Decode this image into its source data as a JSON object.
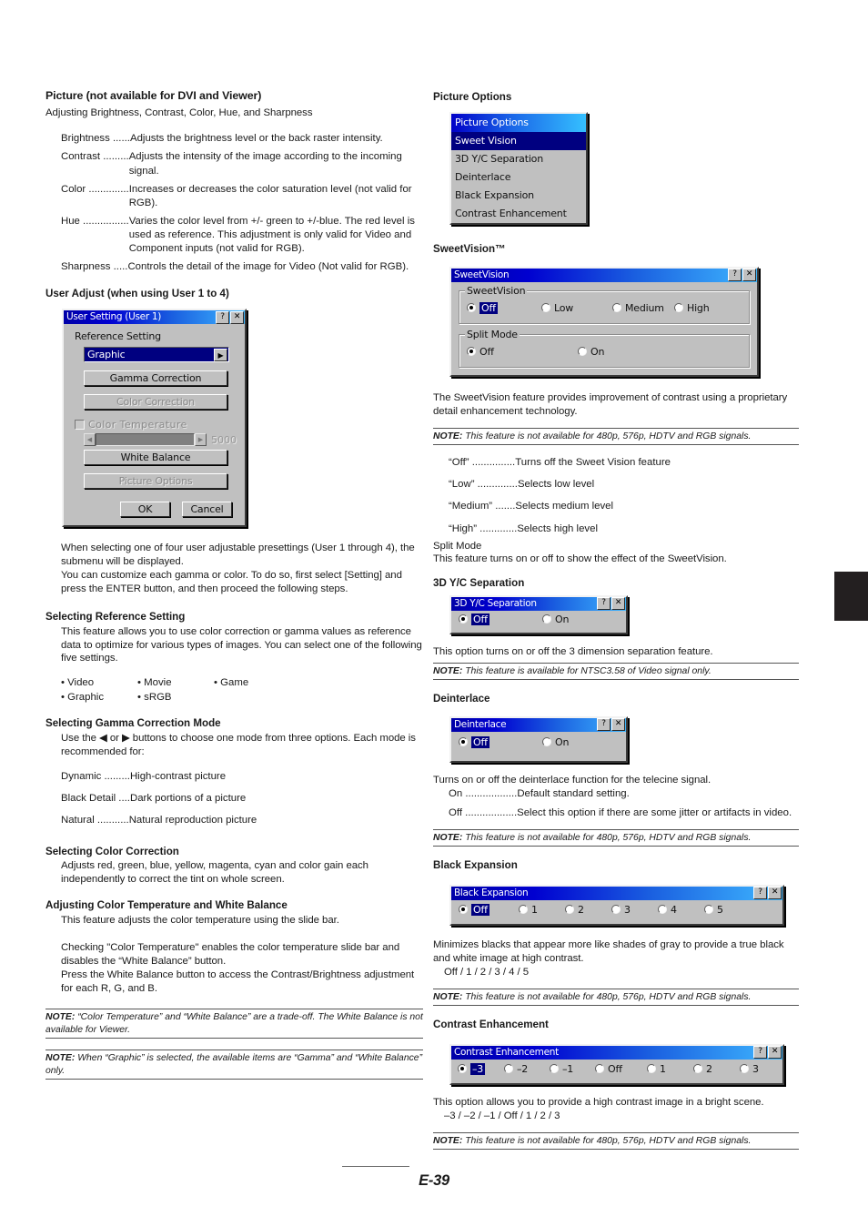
{
  "page": {
    "number": "E-39"
  },
  "left": {
    "heading": "Picture (not available for DVI and Viewer)",
    "subheading": "Adjusting Brightness, Contrast, Color, Hue, and Sharpness",
    "picture_items": [
      {
        "term": "Brightness ......",
        "desc": "Adjusts the brightness level or the back raster intensity."
      },
      {
        "term": "Contrast .........",
        "desc": "Adjusts the intensity of the image according to the incoming signal."
      },
      {
        "term": "Color ..............",
        "desc": "Increases or decreases the color saturation level (not valid for RGB)."
      },
      {
        "term": "Hue ................",
        "desc": "Varies the color level from +/- green to +/-blue. The red level is used as reference. This adjustment is only valid for Video and Component inputs (not valid for RGB)."
      },
      {
        "term": "Sharpness .....",
        "desc": "Controls the detail of the image for Video (Not valid for RGB)."
      }
    ],
    "user_adjust_heading": "User Adjust (when using User 1 to 4)",
    "user_setting_dialog": {
      "title": "User Setting (User 1)",
      "help_button": "?",
      "close_button": "✕",
      "reference_setting_label": "Reference Setting",
      "reference_value": "Graphic",
      "dropdown_arrow": "▶",
      "gamma_correction_button": "Gamma Correction",
      "color_correction_button": "Color Correction",
      "color_temperature_label": "Color Temperature",
      "slider_left_arrow": "◀",
      "slider_right_arrow": "▶",
      "color_temperature_value": "5000",
      "white_balance_button": "White Balance",
      "picture_options_button": "Picture Options",
      "ok_button": "OK",
      "cancel_button": "Cancel"
    },
    "after_dialog_p1": "When selecting one of four user adjustable presettings (User 1 through 4), the submenu will be displayed.",
    "after_dialog_p2": "You can customize each gamma or color. To do so, first select [Setting] and press the ENTER button, and then proceed the following steps.",
    "reference_heading": "Selecting Reference Setting",
    "reference_body": "This feature allows you to use color correction or gamma values as reference data to optimize for various types of images. You can select one of the following five settings.",
    "reference_options": [
      "• Video",
      "• Movie",
      "• Game",
      "• Graphic",
      "• sRGB"
    ],
    "gamma_heading": "Selecting Gamma Correction Mode",
    "gamma_body": "Use the ◀ or ▶ buttons to choose one mode from three options. Each mode is recommended for:",
    "gamma_items": [
      {
        "term": "Dynamic .........",
        "desc": "High-contrast picture"
      },
      {
        "term": "Black Detail ....",
        "desc": "Dark portions of a picture"
      },
      {
        "term": "Natural ...........",
        "desc": "Natural reproduction picture"
      }
    ],
    "color_correction_heading": "Selecting Color Correction",
    "color_correction_body": "Adjusts red, green, blue, yellow, magenta, cyan and color gain each independently to correct the tint on whole screen.",
    "color_temp_heading": "Adjusting Color Temperature and White Balance",
    "color_temp_body": "This feature adjusts the color temperature using the slide bar.",
    "color_temp_p2": "Checking \"Color Temperature\" enables the color temperature slide bar and disables the “White Balance” button.",
    "color_temp_p3": "Press the White Balance button to access the Contrast/Brightness adjustment for each R, G, and B.",
    "note1_label": "NOTE:",
    "note1_text": " “Color Temperature” and “White Balance” are a trade-off. The White Balance is not available for Viewer.",
    "note2_label": "NOTE:",
    "note2_text": " When “Graphic” is selected, the available items are “Gamma” and “White Balance” only."
  },
  "right": {
    "picture_options_heading": "Picture Options",
    "picture_options_menu": [
      {
        "label": "Picture Options",
        "style": "hl-bright"
      },
      {
        "label": "Sweet Vision",
        "style": "hl-dark"
      },
      {
        "label": "3D Y/C Separation",
        "style": ""
      },
      {
        "label": "Deinterlace",
        "style": ""
      },
      {
        "label": "Black Expansion",
        "style": ""
      },
      {
        "label": "Contrast Enhancement",
        "style": ""
      }
    ],
    "sweetvision_heading": "SweetVision™",
    "sweetvision_dialog": {
      "title": "SweetVision",
      "help_button": "?",
      "close_button": "✕",
      "group1_label": "SweetVision",
      "group1_options": [
        {
          "label": "Off",
          "selected": true
        },
        {
          "label": "Low",
          "selected": false
        },
        {
          "label": "Medium",
          "selected": false
        },
        {
          "label": "High",
          "selected": false
        }
      ],
      "group2_label": "Split Mode",
      "group2_options": [
        {
          "label": "Off",
          "selected": true
        },
        {
          "label": "On",
          "selected": false
        }
      ]
    },
    "sweetvision_body": "The SweetVision feature provides improvement of contrast using a proprietary detail enhancement technology.",
    "sweetvision_note_label": "NOTE:",
    "sweetvision_note_text": " This feature is not available for 480p, 576p, HDTV and RGB signals.",
    "sweetvision_items": [
      {
        "term": "“Off” ...............",
        "desc": "Turns off the Sweet Vision feature"
      },
      {
        "term": "“Low” ..............",
        "desc": "Selects low level"
      },
      {
        "term": "“Medium” .......",
        "desc": "Selects medium level"
      },
      {
        "term": "“High” .............",
        "desc": "Selects high level"
      }
    ],
    "split_mode_title": "Split Mode",
    "split_mode_body": "This feature turns on or off to show the effect of the SweetVision.",
    "ycsep_heading": "3D Y/C Separation",
    "ycsep_dialog": {
      "title": "3D Y/C Separation",
      "help_button": "?",
      "close_button": "✕",
      "options": [
        {
          "label": "Off",
          "selected": true
        },
        {
          "label": "On",
          "selected": false
        }
      ]
    },
    "ycsep_body": "This option turns on or off the 3 dimension separation feature.",
    "ycsep_note_label": "NOTE:",
    "ycsep_note_text": " This feature is available for NTSC3.58 of Video signal only.",
    "deinterlace_heading": "Deinterlace",
    "deinterlace_dialog": {
      "title": "Deinterlace",
      "help_button": "?",
      "close_button": "✕",
      "options": [
        {
          "label": "Off",
          "selected": true
        },
        {
          "label": "On",
          "selected": false
        }
      ]
    },
    "deinterlace_body": "Turns on or off the deinterlace function for the telecine signal.",
    "deinterlace_items": [
      {
        "term": "On ..................",
        "desc": "Default standard setting."
      },
      {
        "term": "Off ..................",
        "desc": "Select this option if there are some jitter or artifacts in video."
      }
    ],
    "deinterlace_note_label": "NOTE:",
    "deinterlace_note_text": " This feature is not available for 480p, 576p, HDTV and RGB signals.",
    "blackexp_heading": "Black Expansion",
    "blackexp_dialog": {
      "title": "Black Expansion",
      "help_button": "?",
      "close_button": "✕",
      "options": [
        {
          "label": "Off",
          "selected": true
        },
        {
          "label": "1",
          "selected": false
        },
        {
          "label": "2",
          "selected": false
        },
        {
          "label": "3",
          "selected": false
        },
        {
          "label": "4",
          "selected": false
        },
        {
          "label": "5",
          "selected": false
        }
      ]
    },
    "blackexp_body": "Minimizes blacks that appear more like shades of gray to provide a true black and white image at high contrast.",
    "blackexp_values": "Off / 1 / 2 / 3 / 4 / 5",
    "blackexp_note_label": "NOTE:",
    "blackexp_note_text": " This feature is not available for 480p, 576p, HDTV and RGB signals.",
    "contrast_heading": "Contrast Enhancement",
    "contrast_dialog": {
      "title": "Contrast Enhancement",
      "help_button": "?",
      "close_button": "✕",
      "options": [
        {
          "label": "–3",
          "selected": true
        },
        {
          "label": "–2",
          "selected": false
        },
        {
          "label": "–1",
          "selected": false
        },
        {
          "label": "Off",
          "selected": false
        },
        {
          "label": "1",
          "selected": false
        },
        {
          "label": "2",
          "selected": false
        },
        {
          "label": "3",
          "selected": false
        }
      ]
    },
    "contrast_body": "This option allows you to provide a high contrast image in a bright scene.",
    "contrast_values": "–3 / –2 / –1 / Off / 1 / 2 / 3",
    "contrast_note_label": "NOTE:",
    "contrast_note_text": " This feature is not available for 480p, 576p, HDTV and RGB signals."
  },
  "colors": {
    "titlebar_start": "#0000a8",
    "titlebar_end": "#3fb8ff",
    "dialog_face": "#c0c0c0",
    "selection": "#000080",
    "thumbtab": "#231f20"
  }
}
